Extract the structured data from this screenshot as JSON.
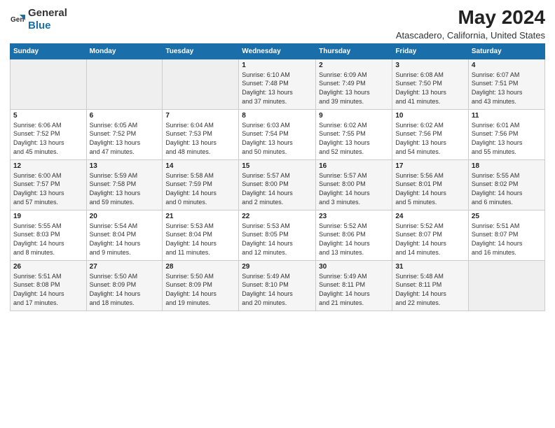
{
  "header": {
    "logo_general": "General",
    "logo_blue": "Blue",
    "title": "May 2024",
    "location": "Atascadero, California, United States"
  },
  "weekdays": [
    "Sunday",
    "Monday",
    "Tuesday",
    "Wednesday",
    "Thursday",
    "Friday",
    "Saturday"
  ],
  "weeks": [
    [
      {
        "num": "",
        "info": ""
      },
      {
        "num": "",
        "info": ""
      },
      {
        "num": "",
        "info": ""
      },
      {
        "num": "1",
        "info": "Sunrise: 6:10 AM\nSunset: 7:48 PM\nDaylight: 13 hours\nand 37 minutes."
      },
      {
        "num": "2",
        "info": "Sunrise: 6:09 AM\nSunset: 7:49 PM\nDaylight: 13 hours\nand 39 minutes."
      },
      {
        "num": "3",
        "info": "Sunrise: 6:08 AM\nSunset: 7:50 PM\nDaylight: 13 hours\nand 41 minutes."
      },
      {
        "num": "4",
        "info": "Sunrise: 6:07 AM\nSunset: 7:51 PM\nDaylight: 13 hours\nand 43 minutes."
      }
    ],
    [
      {
        "num": "5",
        "info": "Sunrise: 6:06 AM\nSunset: 7:52 PM\nDaylight: 13 hours\nand 45 minutes."
      },
      {
        "num": "6",
        "info": "Sunrise: 6:05 AM\nSunset: 7:52 PM\nDaylight: 13 hours\nand 47 minutes."
      },
      {
        "num": "7",
        "info": "Sunrise: 6:04 AM\nSunset: 7:53 PM\nDaylight: 13 hours\nand 48 minutes."
      },
      {
        "num": "8",
        "info": "Sunrise: 6:03 AM\nSunset: 7:54 PM\nDaylight: 13 hours\nand 50 minutes."
      },
      {
        "num": "9",
        "info": "Sunrise: 6:02 AM\nSunset: 7:55 PM\nDaylight: 13 hours\nand 52 minutes."
      },
      {
        "num": "10",
        "info": "Sunrise: 6:02 AM\nSunset: 7:56 PM\nDaylight: 13 hours\nand 54 minutes."
      },
      {
        "num": "11",
        "info": "Sunrise: 6:01 AM\nSunset: 7:56 PM\nDaylight: 13 hours\nand 55 minutes."
      }
    ],
    [
      {
        "num": "12",
        "info": "Sunrise: 6:00 AM\nSunset: 7:57 PM\nDaylight: 13 hours\nand 57 minutes."
      },
      {
        "num": "13",
        "info": "Sunrise: 5:59 AM\nSunset: 7:58 PM\nDaylight: 13 hours\nand 59 minutes."
      },
      {
        "num": "14",
        "info": "Sunrise: 5:58 AM\nSunset: 7:59 PM\nDaylight: 14 hours\nand 0 minutes."
      },
      {
        "num": "15",
        "info": "Sunrise: 5:57 AM\nSunset: 8:00 PM\nDaylight: 14 hours\nand 2 minutes."
      },
      {
        "num": "16",
        "info": "Sunrise: 5:57 AM\nSunset: 8:00 PM\nDaylight: 14 hours\nand 3 minutes."
      },
      {
        "num": "17",
        "info": "Sunrise: 5:56 AM\nSunset: 8:01 PM\nDaylight: 14 hours\nand 5 minutes."
      },
      {
        "num": "18",
        "info": "Sunrise: 5:55 AM\nSunset: 8:02 PM\nDaylight: 14 hours\nand 6 minutes."
      }
    ],
    [
      {
        "num": "19",
        "info": "Sunrise: 5:55 AM\nSunset: 8:03 PM\nDaylight: 14 hours\nand 8 minutes."
      },
      {
        "num": "20",
        "info": "Sunrise: 5:54 AM\nSunset: 8:04 PM\nDaylight: 14 hours\nand 9 minutes."
      },
      {
        "num": "21",
        "info": "Sunrise: 5:53 AM\nSunset: 8:04 PM\nDaylight: 14 hours\nand 11 minutes."
      },
      {
        "num": "22",
        "info": "Sunrise: 5:53 AM\nSunset: 8:05 PM\nDaylight: 14 hours\nand 12 minutes."
      },
      {
        "num": "23",
        "info": "Sunrise: 5:52 AM\nSunset: 8:06 PM\nDaylight: 14 hours\nand 13 minutes."
      },
      {
        "num": "24",
        "info": "Sunrise: 5:52 AM\nSunset: 8:07 PM\nDaylight: 14 hours\nand 14 minutes."
      },
      {
        "num": "25",
        "info": "Sunrise: 5:51 AM\nSunset: 8:07 PM\nDaylight: 14 hours\nand 16 minutes."
      }
    ],
    [
      {
        "num": "26",
        "info": "Sunrise: 5:51 AM\nSunset: 8:08 PM\nDaylight: 14 hours\nand 17 minutes."
      },
      {
        "num": "27",
        "info": "Sunrise: 5:50 AM\nSunset: 8:09 PM\nDaylight: 14 hours\nand 18 minutes."
      },
      {
        "num": "28",
        "info": "Sunrise: 5:50 AM\nSunset: 8:09 PM\nDaylight: 14 hours\nand 19 minutes."
      },
      {
        "num": "29",
        "info": "Sunrise: 5:49 AM\nSunset: 8:10 PM\nDaylight: 14 hours\nand 20 minutes."
      },
      {
        "num": "30",
        "info": "Sunrise: 5:49 AM\nSunset: 8:11 PM\nDaylight: 14 hours\nand 21 minutes."
      },
      {
        "num": "31",
        "info": "Sunrise: 5:48 AM\nSunset: 8:11 PM\nDaylight: 14 hours\nand 22 minutes."
      },
      {
        "num": "",
        "info": ""
      }
    ]
  ]
}
